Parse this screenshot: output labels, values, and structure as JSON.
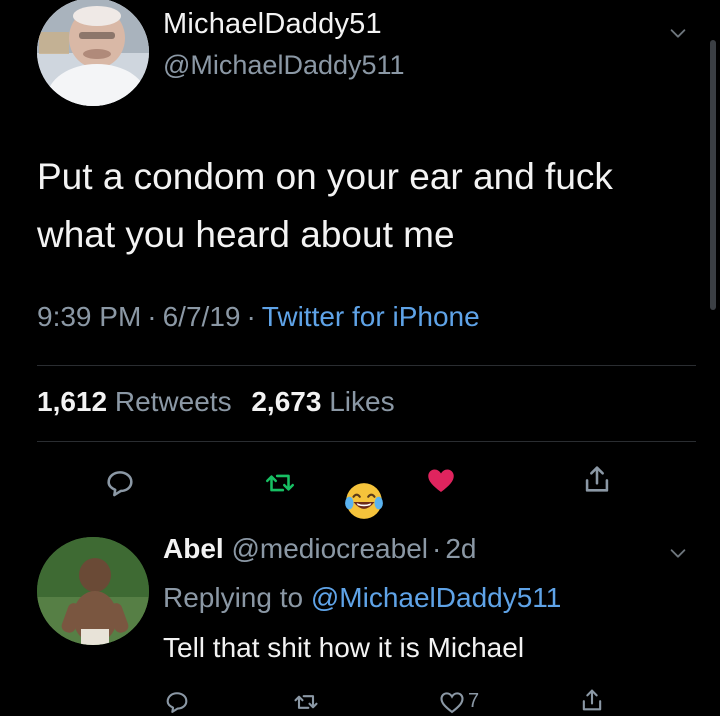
{
  "tweet": {
    "display_name": "MichaelDaddy51",
    "handle": "@MichaelDaddy511",
    "text": "Put a condom on your ear and fuck\nwhat you heard about me",
    "time": "9:39 PM",
    "date": "6/7/19",
    "separator": "·",
    "source": "Twitter for iPhone",
    "retweets_count": "1,612",
    "retweets_label": "Retweets",
    "likes_count": "2,673",
    "likes_label": "Likes"
  },
  "actions": {
    "reply_icon": "reply-icon",
    "retweet_icon": "retweet-icon",
    "like_icon": "heart-icon",
    "share_icon": "share-icon",
    "like_color": "#e0245e",
    "retweet_color": "#17bf63"
  },
  "reaction": {
    "emoji": "laughing-tears-emoji"
  },
  "reply": {
    "display_name": "Abel",
    "handle": "@mediocreabel",
    "separator": "·",
    "age": "2d",
    "replying_prefix": "Replying to",
    "replying_to": "@MichaelDaddy511",
    "text": "Tell that shit how it is Michael",
    "like_count": "7"
  },
  "colors": {
    "background": "#000000",
    "text_primary": "#f3f3f3",
    "text_secondary": "#8b98a5",
    "link": "#5fa3e7"
  }
}
